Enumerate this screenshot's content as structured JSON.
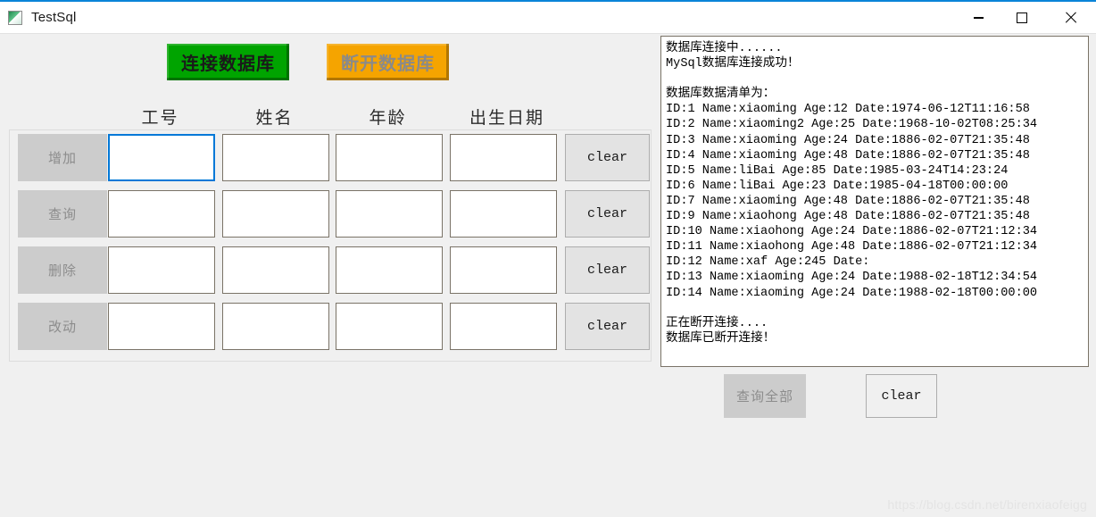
{
  "window": {
    "title": "TestSql",
    "icon": "app-icon",
    "controls": {
      "minimize": "minimize-icon",
      "maximize": "maximize-icon",
      "close": "close-icon"
    }
  },
  "colors": {
    "connect_green": "#00a400",
    "disconnect_orange": "#f5a400",
    "focus_blue": "#0078d7",
    "disabled_gray": "#cccccc",
    "titlebar_accent": "#0a84d8"
  },
  "toolbar": {
    "connect_label": "连接数据库",
    "disconnect_label": "断开数据库"
  },
  "table": {
    "headers": [
      "工号",
      "姓名",
      "年龄",
      "出生日期"
    ],
    "rows": [
      {
        "action_label": "增加",
        "clear_label": "clear",
        "fields": [
          "",
          "",
          "",
          ""
        ],
        "focused_field": 0
      },
      {
        "action_label": "查询",
        "clear_label": "clear",
        "fields": [
          "",
          "",
          "",
          ""
        ],
        "focused_field": -1
      },
      {
        "action_label": "删除",
        "clear_label": "clear",
        "fields": [
          "",
          "",
          "",
          ""
        ],
        "focused_field": -1
      },
      {
        "action_label": "改动",
        "clear_label": "clear",
        "fields": [
          "",
          "",
          "",
          ""
        ],
        "focused_field": -1
      }
    ]
  },
  "log": {
    "text": "数据库连接中......\nMySql数据库连接成功！\n\n数据库数据清单为：\nID:1 Name:xiaoming Age:12 Date:1974-06-12T11:16:58\nID:2 Name:xiaoming2 Age:25 Date:1968-10-02T08:25:34\nID:3 Name:xiaoming Age:24 Date:1886-02-07T21:35:48\nID:4 Name:xiaoming Age:48 Date:1886-02-07T21:35:48\nID:5 Name:liBai Age:85 Date:1985-03-24T14:23:24\nID:6 Name:liBai Age:23 Date:1985-04-18T00:00:00\nID:7 Name:xiaoming Age:48 Date:1886-02-07T21:35:48\nID:9 Name:xiaohong Age:48 Date:1886-02-07T21:35:48\nID:10 Name:xiaohong Age:24 Date:1886-02-07T21:12:34\nID:11 Name:xiaohong Age:48 Date:1886-02-07T21:12:34\nID:12 Name:xaf Age:245 Date:\nID:13 Name:xiaoming Age:24 Date:1988-02-18T12:34:54\nID:14 Name:xiaoming Age:24 Date:1988-02-18T00:00:00\n\n正在断开连接....\n数据库已断开连接！",
    "entries": [
      {
        "id": 1,
        "name": "xiaoming",
        "age": 12,
        "date": "1974-06-12T11:16:58"
      },
      {
        "id": 2,
        "name": "xiaoming2",
        "age": 25,
        "date": "1968-10-02T08:25:34"
      },
      {
        "id": 3,
        "name": "xiaoming",
        "age": 24,
        "date": "1886-02-07T21:35:48"
      },
      {
        "id": 4,
        "name": "xiaoming",
        "age": 48,
        "date": "1886-02-07T21:35:48"
      },
      {
        "id": 5,
        "name": "liBai",
        "age": 85,
        "date": "1985-03-24T14:23:24"
      },
      {
        "id": 6,
        "name": "liBai",
        "age": 23,
        "date": "1985-04-18T00:00:00"
      },
      {
        "id": 7,
        "name": "xiaoming",
        "age": 48,
        "date": "1886-02-07T21:35:48"
      },
      {
        "id": 9,
        "name": "xiaohong",
        "age": 48,
        "date": "1886-02-07T21:35:48"
      },
      {
        "id": 10,
        "name": "xiaohong",
        "age": 24,
        "date": "1886-02-07T21:12:34"
      },
      {
        "id": 11,
        "name": "xiaohong",
        "age": 48,
        "date": "1886-02-07T21:12:34"
      },
      {
        "id": 12,
        "name": "xaf",
        "age": 245,
        "date": ""
      },
      {
        "id": 13,
        "name": "xiaoming",
        "age": 24,
        "date": "1988-02-18T12:34:54"
      },
      {
        "id": 14,
        "name": "xiaoming",
        "age": 24,
        "date": "1988-02-18T00:00:00"
      }
    ]
  },
  "footer": {
    "query_all_label": "查询全部",
    "clear_log_label": "clear"
  },
  "watermark": "https://blog.csdn.net/birenxiaofeigg"
}
